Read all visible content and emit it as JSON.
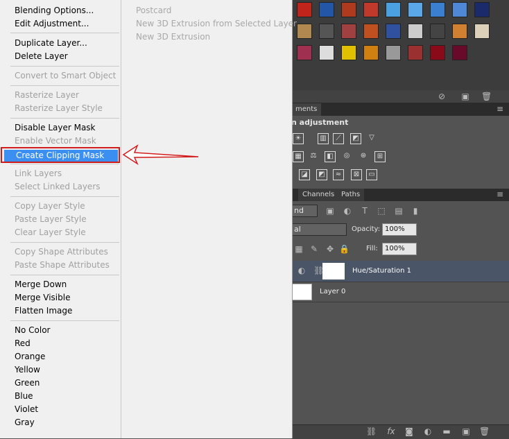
{
  "context_menu": {
    "items": [
      {
        "label": "Blending Options...",
        "enabled": true
      },
      {
        "label": "Edit Adjustment...",
        "enabled": true
      },
      {
        "label": "Duplicate Layer...",
        "enabled": true
      },
      {
        "label": "Delete Layer",
        "enabled": true
      },
      {
        "label": "Convert to Smart Object",
        "enabled": false
      },
      {
        "label": "Rasterize Layer",
        "enabled": false
      },
      {
        "label": "Rasterize Layer Style",
        "enabled": false
      },
      {
        "label": "Disable Layer Mask",
        "enabled": true
      },
      {
        "label": "Enable Vector Mask",
        "enabled": false
      },
      {
        "label": "Create Clipping Mask",
        "enabled": true,
        "highlighted": true
      },
      {
        "label": "Link Layers",
        "enabled": false
      },
      {
        "label": "Select Linked Layers",
        "enabled": false
      },
      {
        "label": "Copy Layer Style",
        "enabled": false
      },
      {
        "label": "Paste Layer Style",
        "enabled": false
      },
      {
        "label": "Clear Layer Style",
        "enabled": false
      },
      {
        "label": "Copy Shape Attributes",
        "enabled": false
      },
      {
        "label": "Paste Shape Attributes",
        "enabled": false
      },
      {
        "label": "Merge Down",
        "enabled": true
      },
      {
        "label": "Merge Visible",
        "enabled": true
      },
      {
        "label": "Flatten Image",
        "enabled": true
      },
      {
        "label": "No Color",
        "enabled": true
      },
      {
        "label": "Red",
        "enabled": true
      },
      {
        "label": "Orange",
        "enabled": true
      },
      {
        "label": "Yellow",
        "enabled": true
      },
      {
        "label": "Green",
        "enabled": true
      },
      {
        "label": "Blue",
        "enabled": true
      },
      {
        "label": "Violet",
        "enabled": true
      },
      {
        "label": "Gray",
        "enabled": true
      }
    ],
    "submenu": [
      {
        "label": "Postcard",
        "enabled": false
      },
      {
        "label": "New 3D Extrusion from Selected Layer",
        "enabled": false
      },
      {
        "label": "New 3D Extrusion",
        "enabled": false
      }
    ],
    "highlight_color": "#3a8ff0",
    "annotation_color": "#d11a1a"
  },
  "panels": {
    "adjustments": {
      "tab": "ments",
      "title": "n adjustment"
    },
    "layers": {
      "tabs": [
        "Channels",
        "Paths"
      ],
      "kind": "nd",
      "blend_mode": "al",
      "opacity_label": "Opacity:",
      "opacity": "100%",
      "fill_label": "Fill:",
      "fill": "100%",
      "layers": [
        {
          "name": "Hue/Saturation 1",
          "selected": true
        },
        {
          "name": "Layer 0",
          "selected": false
        }
      ],
      "footer_icons": [
        "link-icon",
        "fx-icon",
        "mask-icon",
        "adjustment-icon",
        "folder-icon",
        "new-layer-icon",
        "trash-icon"
      ]
    }
  }
}
